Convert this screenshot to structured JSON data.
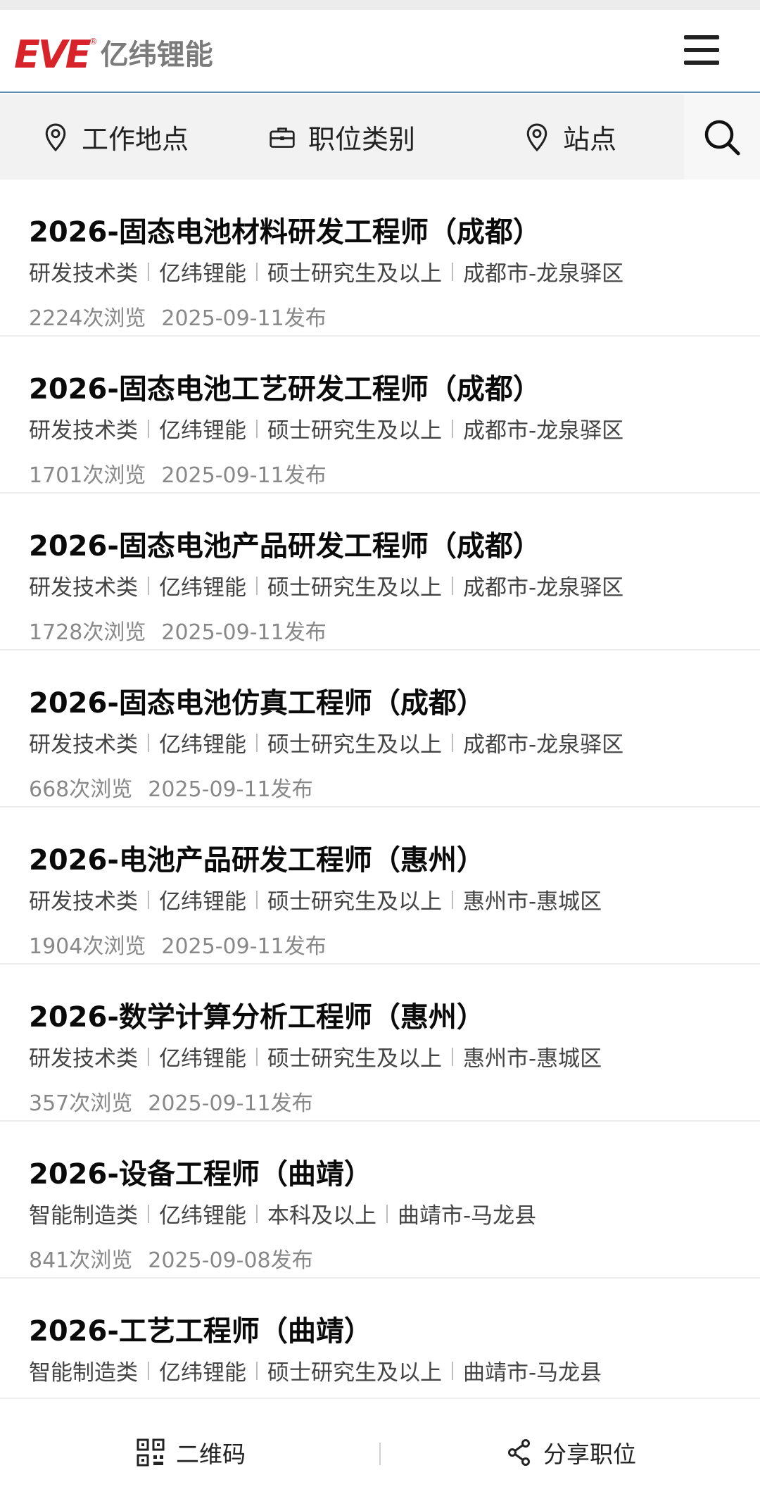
{
  "brand": {
    "logo_mark": "EVE",
    "logo_reg": "®",
    "logo_text": "亿纬锂能"
  },
  "filters": {
    "location_label": "工作地点",
    "category_label": "职位类别",
    "site_label": "站点"
  },
  "jobs": [
    {
      "title": "2026-固态电池材料研发工程师（成都）",
      "category": "研发技术类",
      "company": "亿纬锂能",
      "education": "硕士研究生及以上",
      "location": "成都市-龙泉驿区",
      "views": "2224次浏览",
      "date": "2025-09-11发布"
    },
    {
      "title": "2026-固态电池工艺研发工程师（成都）",
      "category": "研发技术类",
      "company": "亿纬锂能",
      "education": "硕士研究生及以上",
      "location": "成都市-龙泉驿区",
      "views": "1701次浏览",
      "date": "2025-09-11发布"
    },
    {
      "title": "2026-固态电池产品研发工程师（成都）",
      "category": "研发技术类",
      "company": "亿纬锂能",
      "education": "硕士研究生及以上",
      "location": "成都市-龙泉驿区",
      "views": "1728次浏览",
      "date": "2025-09-11发布"
    },
    {
      "title": "2026-固态电池仿真工程师（成都）",
      "category": "研发技术类",
      "company": "亿纬锂能",
      "education": "硕士研究生及以上",
      "location": "成都市-龙泉驿区",
      "views": "668次浏览",
      "date": "2025-09-11发布"
    },
    {
      "title": "2026-电池产品研发工程师（惠州）",
      "category": "研发技术类",
      "company": "亿纬锂能",
      "education": "硕士研究生及以上",
      "location": "惠州市-惠城区",
      "views": "1904次浏览",
      "date": "2025-09-11发布"
    },
    {
      "title": "2026-数学计算分析工程师（惠州）",
      "category": "研发技术类",
      "company": "亿纬锂能",
      "education": "硕士研究生及以上",
      "location": "惠州市-惠城区",
      "views": "357次浏览",
      "date": "2025-09-11发布"
    },
    {
      "title": "2026-设备工程师（曲靖）",
      "category": "智能制造类",
      "company": "亿纬锂能",
      "education": "本科及以上",
      "location": "曲靖市-马龙县",
      "views": "841次浏览",
      "date": "2025-09-08发布"
    },
    {
      "title": "2026-工艺工程师（曲靖）",
      "category": "智能制造类",
      "company": "亿纬锂能",
      "education": "硕士研究生及以上",
      "location": "曲靖市-马龙县",
      "views": "",
      "date": ""
    }
  ],
  "bottom": {
    "qr_label": "二维码",
    "share_label": "分享职位"
  },
  "colors": {
    "brand_red": "#d8232a",
    "filter_bg": "#f2f2f2",
    "meta_gray": "#888888"
  }
}
